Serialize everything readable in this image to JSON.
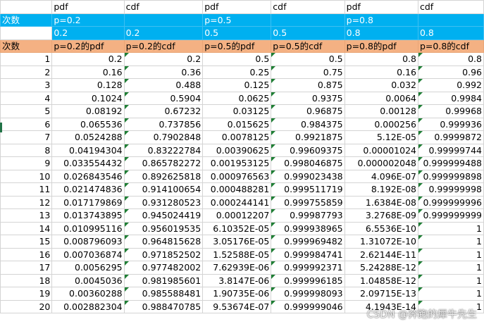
{
  "header_row1": [
    "",
    "pdf",
    "cdf",
    "pdf",
    "cdf",
    "pdf",
    "cdf"
  ],
  "header_row2": [
    "次数",
    "p=0.2",
    "",
    "p=0.5",
    "",
    "p=0.8",
    ""
  ],
  "header_row3": [
    "",
    "0.2",
    "0.2",
    "0.5",
    "0.5",
    "0.8",
    "0.8"
  ],
  "header_row4": [
    "次数",
    "p=0.2的pdf",
    "p=0.2的cdf",
    "p=0.5的pdf",
    "p=0.5的cdf",
    "p=0.8的pdf",
    "p=0.8的cdf"
  ],
  "rows": [
    [
      "1",
      "0.2",
      "0.2",
      "0.5",
      "0.5",
      "0.8",
      "0.8"
    ],
    [
      "2",
      "0.16",
      "0.36",
      "0.25",
      "0.75",
      "0.16",
      "0.96"
    ],
    [
      "3",
      "0.128",
      "0.488",
      "0.125",
      "0.875",
      "0.032",
      "0.992"
    ],
    [
      "4",
      "0.1024",
      "0.5904",
      "0.0625",
      "0.9375",
      "0.0064",
      "0.9984"
    ],
    [
      "5",
      "0.08192",
      "0.67232",
      "0.03125",
      "0.96875",
      "0.00128",
      "0.99968"
    ],
    [
      "6",
      "0.065536",
      "0.737856",
      "0.015625",
      "0.984375",
      "0.000256",
      "0.999936"
    ],
    [
      "7",
      "0.0524288",
      "0.7902848",
      "0.0078125",
      "0.9921875",
      "5.12E-05",
      "0.9999872"
    ],
    [
      "8",
      "0.04194304",
      "0.83222784",
      "0.00390625",
      "0.99609375",
      "0.00001024",
      "0.99999744"
    ],
    [
      "9",
      "0.033554432",
      "0.865782272",
      "0.001953125",
      "0.998046875",
      "0.000002048",
      "0.999999488"
    ],
    [
      "10",
      "0.026843546",
      "0.892625818",
      "0.000976563",
      "0.999023438",
      "4.096E-07",
      "0.999999898"
    ],
    [
      "11",
      "0.021474836",
      "0.914100654",
      "0.000488281",
      "0.999511719",
      "8.192E-08",
      "0.99999998"
    ],
    [
      "12",
      "0.017179869",
      "0.931280523",
      "0.000244141",
      "0.999755859",
      "1.6384E-08",
      "0.999999996"
    ],
    [
      "13",
      "0.013743895",
      "0.945024419",
      "0.00012207",
      "0.99987793",
      "3.2768E-09",
      "0.999999999"
    ],
    [
      "14",
      "0.010995116",
      "0.956019535",
      "6.10352E-05",
      "0.999938965",
      "6.5536E-10",
      "1"
    ],
    [
      "15",
      "0.008796093",
      "0.964815628",
      "3.05176E-05",
      "0.999969482",
      "1.31072E-10",
      "1"
    ],
    [
      "16",
      "0.007036874",
      "0.971852502",
      "1.52588E-05",
      "0.999984741",
      "2.62144E-11",
      "1"
    ],
    [
      "17",
      "0.0056295",
      "0.977482002",
      "7.62939E-06",
      "0.999992371",
      "5.24288E-12",
      "1"
    ],
    [
      "18",
      "0.0045036",
      "0.981985601",
      "3.8147E-06",
      "0.999996185",
      "1.04858E-12",
      "1"
    ],
    [
      "19",
      "0.00360288",
      "0.985588481",
      "1.90735E-06",
      "0.999998093",
      "2.09715E-13",
      "1"
    ],
    [
      "20",
      "0.002882304",
      "0.988470785",
      "9.53674E-07",
      "0.999999046",
      "4.1943E-14",
      "1"
    ]
  ],
  "watermark": "CSDN @奔跑的犀牛先生",
  "colors": {
    "header_blue": "#00b0f0",
    "header_orange": "#f4b183"
  }
}
